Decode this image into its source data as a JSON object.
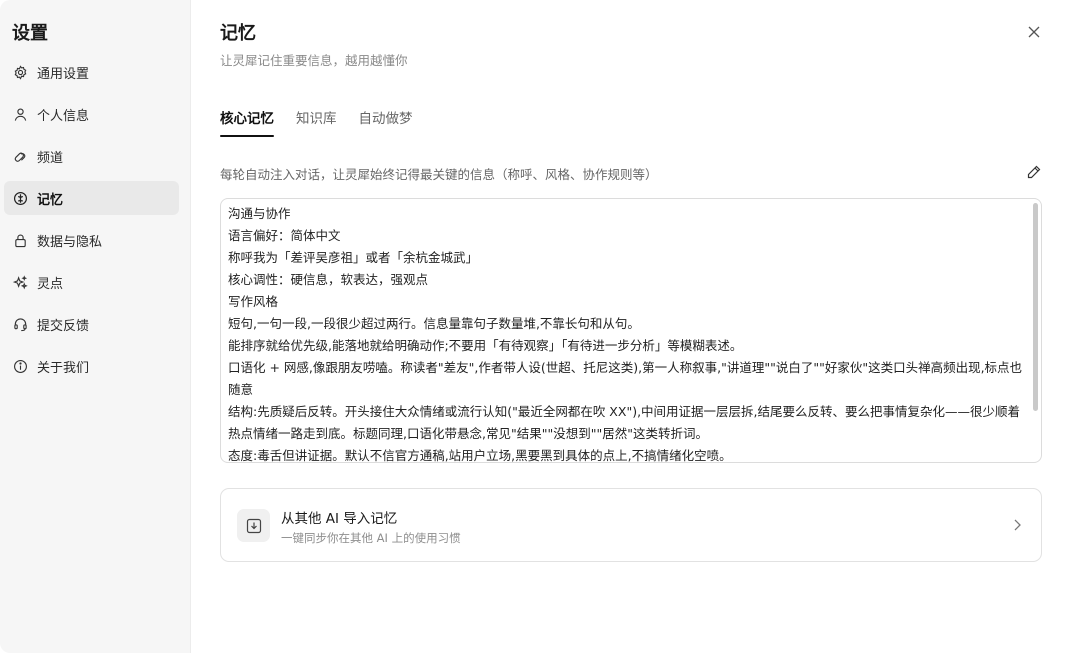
{
  "sidebar": {
    "title": "设置",
    "items": [
      {
        "label": "通用设置",
        "icon": "gear-icon"
      },
      {
        "label": "个人信息",
        "icon": "user-icon"
      },
      {
        "label": "频道",
        "icon": "channel-icon"
      },
      {
        "label": "记忆",
        "icon": "memory-icon",
        "active": true
      },
      {
        "label": "数据与隐私",
        "icon": "lock-icon"
      },
      {
        "label": "灵点",
        "icon": "sparkle-icon"
      },
      {
        "label": "提交反馈",
        "icon": "feedback-icon"
      },
      {
        "label": "关于我们",
        "icon": "info-icon"
      }
    ]
  },
  "header": {
    "title": "记忆",
    "subtitle": "让灵犀记住重要信息，越用越懂你"
  },
  "tabs": [
    {
      "label": "核心记忆",
      "active": true
    },
    {
      "label": "知识库"
    },
    {
      "label": "自动做梦"
    }
  ],
  "memory": {
    "description": "每轮自动注入对话，让灵犀始终记得最关键的信息（称呼、风格、协作规则等）",
    "lines": [
      "沟通与协作",
      "语言偏好：简体中文",
      "称呼我为「差评吴彦祖」或者「余杭金城武」",
      "核心调性：硬信息，软表达，强观点",
      "写作风格",
      "短句,一句一段,一段很少超过两行。信息量靠句子数量堆,不靠长句和从句。",
      "能排序就给优先级,能落地就给明确动作;不要用「有待观察」「有待进一步分析」等模糊表述。",
      "口语化 + 网感,像跟朋友唠嗑。称读者\"差友\",作者带人设(世超、托尼这类),第一人称叙事,\"讲道理\"\"说白了\"\"好家伙\"这类口头禅高频出现,标点也随意",
      "结构:先质疑后反转。开头接住大众情绪或流行认知(\"最近全网都在吹 XX\"),中间用证据一层层拆,结尾要么反转、要么把事情复杂化——很少顺着热点情绪一路走到底。标题同理,口语化带悬念,常见\"结果\"\"没想到\"\"居然\"这类转折词。",
      "态度:毒舌但讲证据。默认不信官方通稿,站用户立场,黑要黑到具体的点上,不搞情绪化空喷。"
    ]
  },
  "import": {
    "title": "从其他 AI 导入记忆",
    "subtitle": "一键同步你在其他 AI 上的使用习惯",
    "icon": "import-icon"
  },
  "colors": {
    "sidebar_bg": "#f6f6f6",
    "active_item_bg": "#e9e9e9",
    "text_primary": "#1a1a1a",
    "text_secondary": "#8a8a8a"
  }
}
